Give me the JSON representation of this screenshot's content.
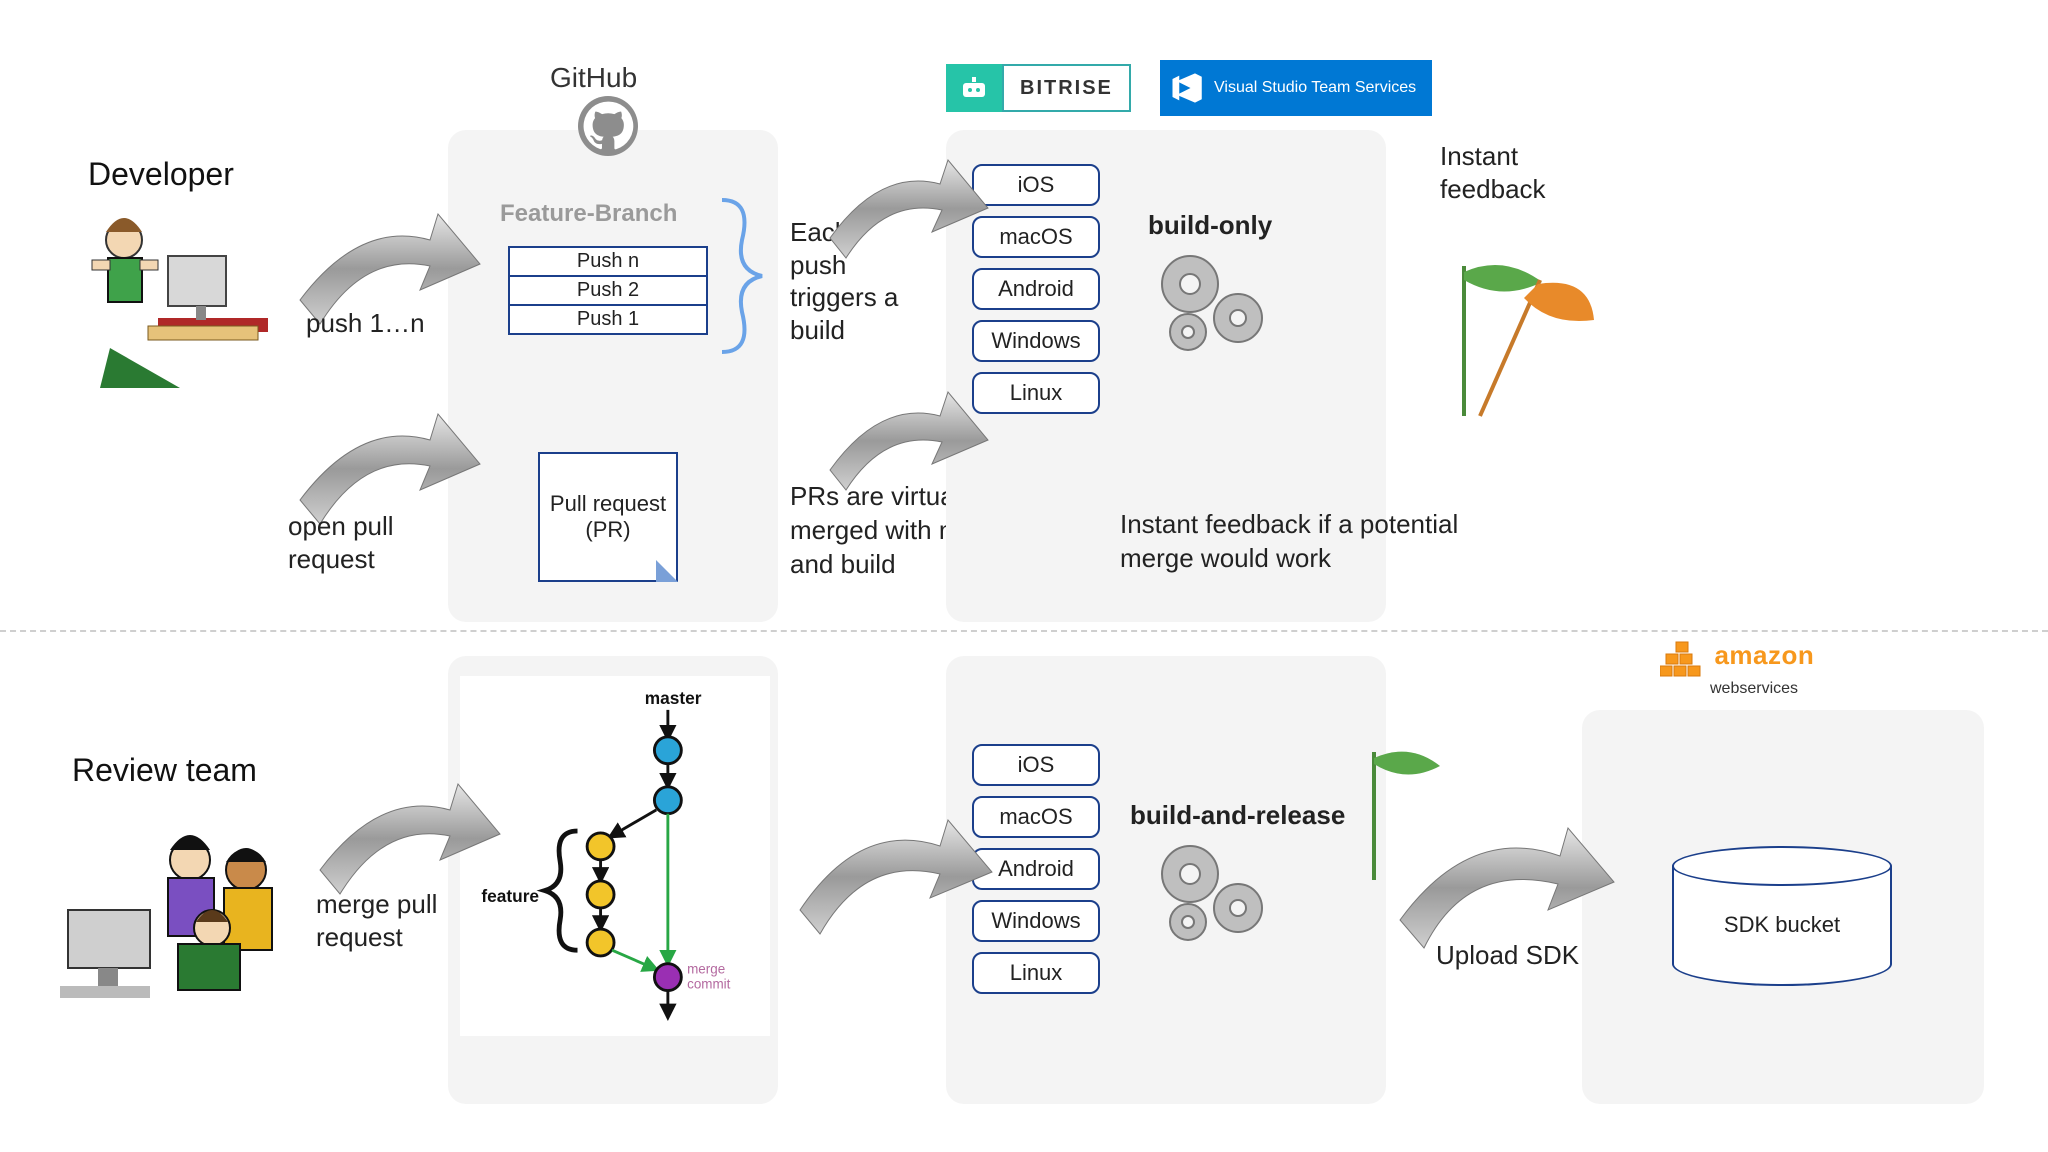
{
  "roles": {
    "developer": "Developer",
    "review_team": "Review team"
  },
  "github": {
    "heading": "GitHub",
    "feature_branch": "Feature-Branch",
    "pushes": [
      "Push n",
      "Push 2",
      "Push 1"
    ],
    "pr_card": "Pull request (PR)",
    "merge_diagram": {
      "master_label": "master",
      "feature_label": "feature",
      "merge_label": "merge\ncommit"
    }
  },
  "dev_arrows": {
    "push": "push 1…n",
    "open_pr": "open pull request",
    "merge_pr": "merge pull request"
  },
  "notes": {
    "each_push": "Each push triggers a build",
    "prs_merged": "PRs are virtually merged with master and build",
    "instant_feedback_title": "Instant feedback",
    "instant_feedback_pr": "Instant feedback if a potential merge would work",
    "upload_sdk": "Upload SDK"
  },
  "ci": {
    "bitrise": "BITRISE",
    "vsts": "Visual Studio Team Services",
    "platforms": [
      "iOS",
      "macOS",
      "Android",
      "Windows",
      "Linux"
    ],
    "build_only": "build-only",
    "build_release": "build-and-release"
  },
  "aws": {
    "brand_top": "amazon",
    "brand_bottom": "webservices",
    "bucket": "SDK bucket"
  }
}
